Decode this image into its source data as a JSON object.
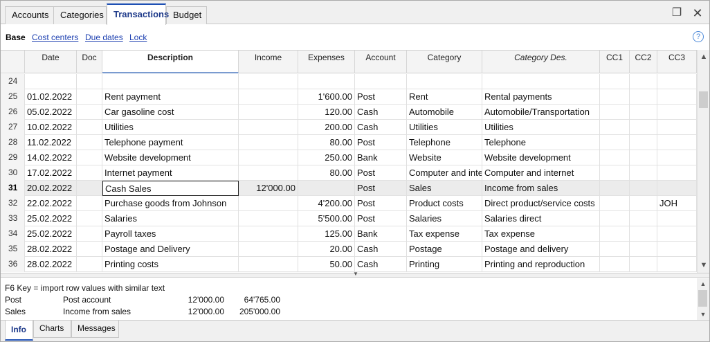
{
  "tabs": [
    "Accounts",
    "Categories",
    "Transactions",
    "Budget"
  ],
  "active_tab": "Transactions",
  "views": [
    "Base",
    "Cost centers",
    "Due dates",
    "Lock"
  ],
  "columns": [
    "Date",
    "Doc",
    "Description",
    "Income",
    "Expenses",
    "Account",
    "Category",
    "Category Des.",
    "CC1",
    "CC2",
    "CC3"
  ],
  "rows": [
    {
      "n": "24",
      "date": "",
      "doc": "",
      "desc": "",
      "income": "",
      "expenses": "",
      "account": "",
      "category": "",
      "catdes": "",
      "cc1": "",
      "cc2": "",
      "cc3": ""
    },
    {
      "n": "25",
      "date": "01.02.2022",
      "doc": "",
      "desc": "Rent payment",
      "income": "",
      "expenses": "1'600.00",
      "account": "Post",
      "category": "Rent",
      "catdes": "Rental payments",
      "cc1": "",
      "cc2": "",
      "cc3": ""
    },
    {
      "n": "26",
      "date": "05.02.2022",
      "doc": "",
      "desc": "Car gasoline cost",
      "income": "",
      "expenses": "120.00",
      "account": "Cash",
      "category": "Automobile",
      "catdes": "Automobile/Transportation",
      "cc1": "",
      "cc2": "",
      "cc3": ""
    },
    {
      "n": "27",
      "date": "10.02.2022",
      "doc": "",
      "desc": "Utilities",
      "income": "",
      "expenses": "200.00",
      "account": "Cash",
      "category": "Utilities",
      "catdes": "Utilities",
      "cc1": "",
      "cc2": "",
      "cc3": ""
    },
    {
      "n": "28",
      "date": "11.02.2022",
      "doc": "",
      "desc": "Telephone payment",
      "income": "",
      "expenses": "80.00",
      "account": "Post",
      "category": "Telephone",
      "catdes": "Telephone",
      "cc1": "",
      "cc2": "",
      "cc3": ""
    },
    {
      "n": "29",
      "date": "14.02.2022",
      "doc": "",
      "desc": "Website development",
      "income": "",
      "expenses": "250.00",
      "account": "Bank",
      "category": "Website",
      "catdes": "Website development",
      "cc1": "",
      "cc2": "",
      "cc3": ""
    },
    {
      "n": "30",
      "date": "17.02.2022",
      "doc": "",
      "desc": "Internet payment",
      "income": "",
      "expenses": "80.00",
      "account": "Post",
      "category": "Computer and inte",
      "catdes": "Computer and internet",
      "cc1": "",
      "cc2": "",
      "cc3": ""
    },
    {
      "n": "31",
      "date": "20.02.2022",
      "doc": "",
      "desc": "Cash Sales",
      "income": "12'000.00",
      "expenses": "",
      "account": "Post",
      "category": "Sales",
      "catdes": "Income from sales",
      "cc1": "",
      "cc2": "",
      "cc3": ""
    },
    {
      "n": "32",
      "date": "22.02.2022",
      "doc": "",
      "desc": "Purchase goods from Johnson",
      "income": "",
      "expenses": "4'200.00",
      "account": "Post",
      "category": "Product costs",
      "catdes": "Direct product/service costs",
      "cc1": "",
      "cc2": "",
      "cc3": "JOH"
    },
    {
      "n": "33",
      "date": "25.02.2022",
      "doc": "",
      "desc": "Salaries",
      "income": "",
      "expenses": "5'500.00",
      "account": "Post",
      "category": "Salaries",
      "catdes": "Salaries direct",
      "cc1": "",
      "cc2": "",
      "cc3": ""
    },
    {
      "n": "34",
      "date": "25.02.2022",
      "doc": "",
      "desc": "Payroll taxes",
      "income": "",
      "expenses": "125.00",
      "account": "Bank",
      "category": "Tax expense",
      "catdes": "Tax expense",
      "cc1": "",
      "cc2": "",
      "cc3": ""
    },
    {
      "n": "35",
      "date": "28.02.2022",
      "doc": "",
      "desc": "Postage and Delivery",
      "income": "",
      "expenses": "20.00",
      "account": "Cash",
      "category": "Postage",
      "catdes": "Postage and delivery",
      "cc1": "",
      "cc2": "",
      "cc3": ""
    },
    {
      "n": "36",
      "date": "28.02.2022",
      "doc": "",
      "desc": "Printing costs",
      "income": "",
      "expenses": "50.00",
      "account": "Cash",
      "category": "Printing",
      "catdes": "Printing and reproduction",
      "cc1": "",
      "cc2": "",
      "cc3": ""
    }
  ],
  "current_row": "31",
  "info": {
    "hint": "F6 Key = import row values with similar text",
    "lines": [
      {
        "code": "Post",
        "name": "Post account",
        "v1": "12'000.00",
        "v2": "64'765.00"
      },
      {
        "code": "Sales",
        "name": "Income from sales",
        "v1": "12'000.00",
        "v2": "205'000.00"
      }
    ]
  },
  "bottom_tabs": [
    "Info",
    "Charts",
    "Messages"
  ],
  "active_bottom_tab": "Info",
  "icons": {
    "restore": "restore-icon",
    "close": "close-icon",
    "help": "help-icon"
  }
}
